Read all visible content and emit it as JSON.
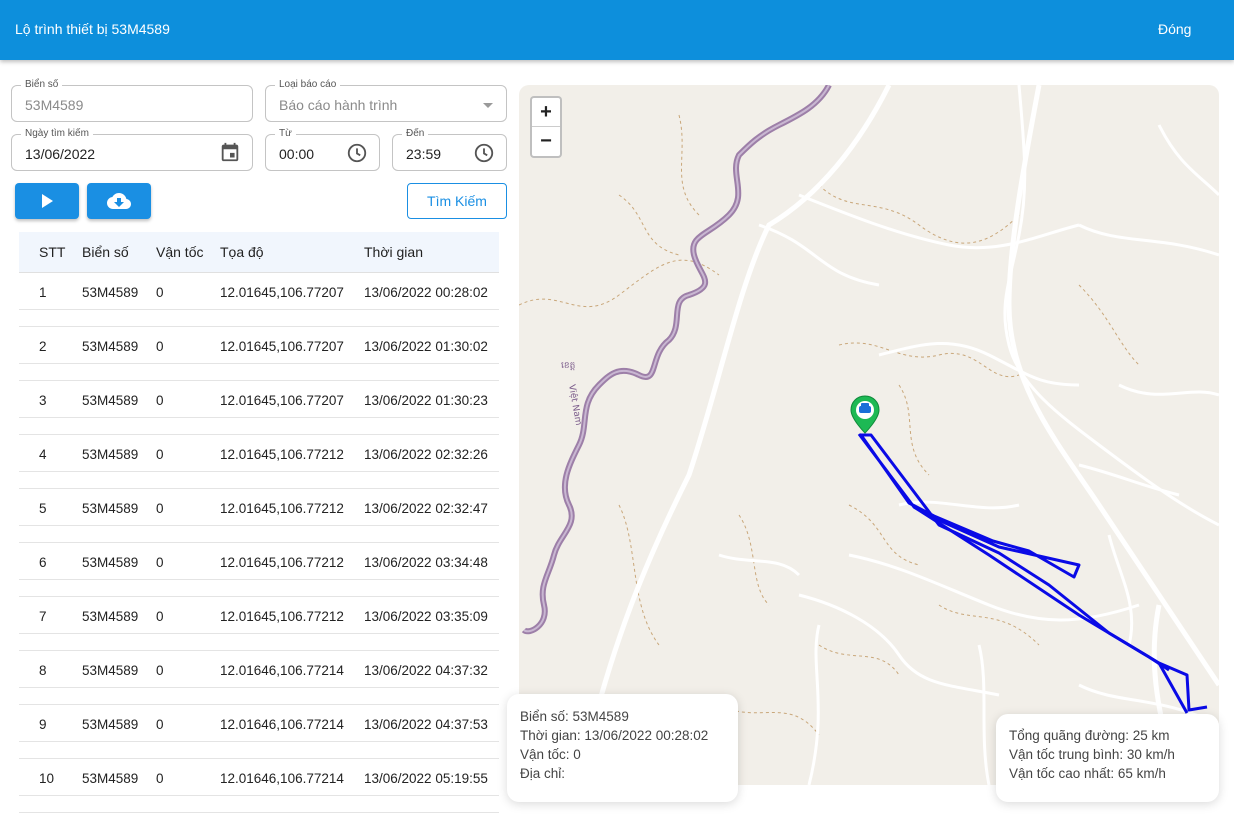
{
  "header": {
    "title": "Lộ trình thiết bị 53M4589",
    "close_label": "Đóng"
  },
  "form": {
    "plate": {
      "label": "Biển số",
      "value": "53M4589"
    },
    "report_type": {
      "label": "Loại báo cáo",
      "value": "Báo cáo hành trình"
    },
    "search_date": {
      "label": "Ngày tìm kiếm",
      "value": "13/06/2022"
    },
    "from": {
      "label": "Từ",
      "value": "00:00"
    },
    "to": {
      "label": "Đến",
      "value": "23:59"
    },
    "search_label": "Tìm Kiếm"
  },
  "table": {
    "headers": [
      "STT",
      "Biển số",
      "Vận tốc",
      "Tọa độ",
      "Thời gian"
    ],
    "rows": [
      [
        "1",
        "53M4589",
        "0",
        "12.01645,106.77207",
        "13/06/2022 00:28:02"
      ],
      [
        "2",
        "53M4589",
        "0",
        "12.01645,106.77207",
        "13/06/2022 01:30:02"
      ],
      [
        "3",
        "53M4589",
        "0",
        "12.01645,106.77207",
        "13/06/2022 01:30:23"
      ],
      [
        "4",
        "53M4589",
        "0",
        "12.01645,106.77212",
        "13/06/2022 02:32:26"
      ],
      [
        "5",
        "53M4589",
        "0",
        "12.01645,106.77212",
        "13/06/2022 02:32:47"
      ],
      [
        "6",
        "53M4589",
        "0",
        "12.01645,106.77212",
        "13/06/2022 03:34:48"
      ],
      [
        "7",
        "53M4589",
        "0",
        "12.01645,106.77212",
        "13/06/2022 03:35:09"
      ],
      [
        "8",
        "53M4589",
        "0",
        "12.01646,106.77214",
        "13/06/2022 04:37:32"
      ],
      [
        "9",
        "53M4589",
        "0",
        "12.01646,106.77214",
        "13/06/2022 04:37:53"
      ],
      [
        "10",
        "53M4589",
        "0",
        "12.01646,106.77214",
        "13/06/2022 05:19:55"
      ]
    ]
  },
  "map": {
    "zoom_in": "+",
    "zoom_out": "−",
    "border_label_khmer": "ខេត្ត",
    "border_label_vn": "Việt Nam",
    "route_color": "#0a0ae6",
    "marker_color": "#1db954",
    "border_color": "#9d7fa8"
  },
  "info_card": {
    "plate": "Biển số: 53M4589",
    "time": "Thời gian: 13/06/2022 00:28:02",
    "speed": "Vận tốc: 0",
    "address": "Địa chỉ:"
  },
  "summary_card": {
    "distance": "Tổng quãng đường: 25 km",
    "avg_speed": "Vận tốc trung bình: 30 km/h",
    "max_speed": "Vận tốc cao nhất: 65 km/h"
  }
}
